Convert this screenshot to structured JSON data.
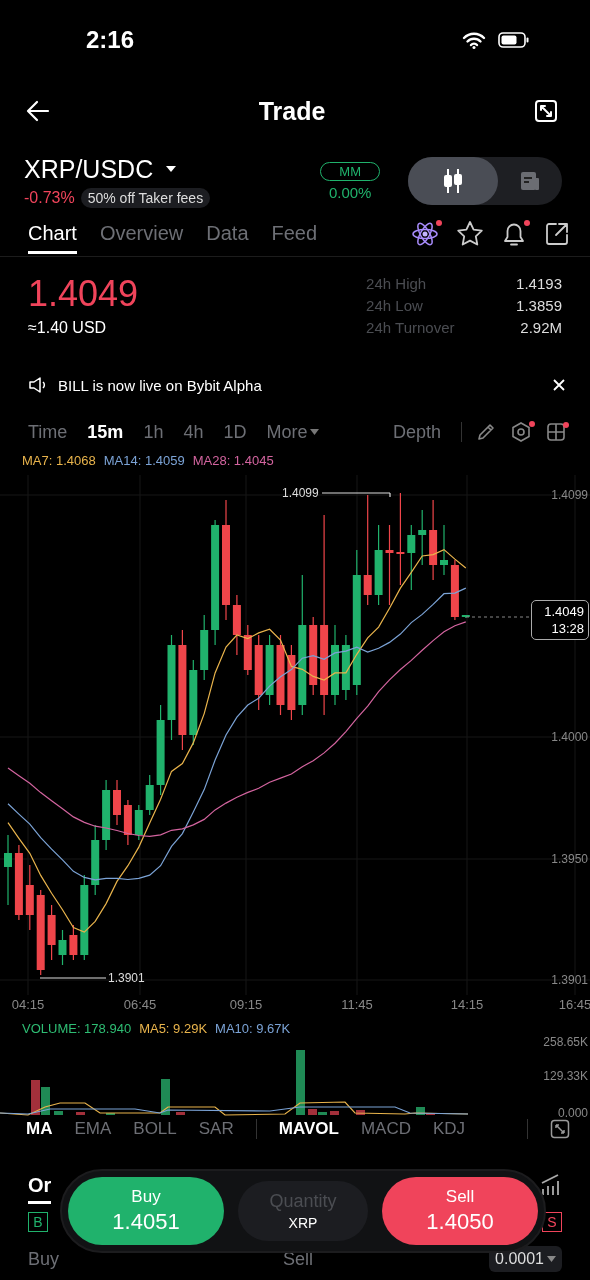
{
  "status_bar": {
    "time": "2:16"
  },
  "header": {
    "title": "Trade"
  },
  "pair": {
    "symbol": "XRP/USDC",
    "change": "-0.73%",
    "promo": "50% off Taker fees",
    "mm_label": "MM",
    "mm_value": "0.00%"
  },
  "view_toggle": [
    {
      "kind": "candles",
      "selected": true
    },
    {
      "kind": "news",
      "selected": false
    }
  ],
  "tabs": [
    {
      "label": "Chart",
      "selected": true
    },
    {
      "label": "Overview",
      "selected": false
    },
    {
      "label": "Data",
      "selected": false
    },
    {
      "label": "Feed",
      "selected": false
    }
  ],
  "tab_icons": [
    {
      "kind": "atom",
      "dot": true
    },
    {
      "kind": "star",
      "dot": false
    },
    {
      "kind": "bell",
      "dot": true
    },
    {
      "kind": "share",
      "dot": false
    }
  ],
  "price": {
    "last": "1.4049",
    "usd": "≈1.40 USD"
  },
  "stats": [
    {
      "label": "24h High",
      "value": "1.4193"
    },
    {
      "label": "24h Low",
      "value": "1.3859"
    },
    {
      "label": "24h Turnover",
      "value": "2.92M"
    }
  ],
  "notice": {
    "text": "BILL is now live on Bybit Alpha"
  },
  "intervals": [
    {
      "label": "Time",
      "selected": false,
      "dropdown": false
    },
    {
      "label": "15m",
      "selected": true,
      "dropdown": false
    },
    {
      "label": "1h",
      "selected": false,
      "dropdown": false
    },
    {
      "label": "4h",
      "selected": false,
      "dropdown": false
    },
    {
      "label": "1D",
      "selected": false,
      "dropdown": false
    },
    {
      "label": "More",
      "selected": false,
      "dropdown": true
    }
  ],
  "depth": "Depth",
  "chart_tools": [
    {
      "kind": "pencil",
      "dot": false
    },
    {
      "kind": "hexagon",
      "dot": true
    },
    {
      "kind": "grid",
      "dot": true
    }
  ],
  "ma_legend": [
    {
      "text": "MA7: 1.4068",
      "color": "#e9b44c"
    },
    {
      "text": "MA14: 1.4059",
      "color": "#7ba3d6"
    },
    {
      "text": "MA28: 1.4045",
      "color": "#d3649f"
    }
  ],
  "chart": {
    "high_label": "1.4099",
    "low_label": "1.3901",
    "y_labels": [
      "1.4099",
      "1.4000",
      "1.3950",
      "1.3901"
    ],
    "price_tag": {
      "value": "1.4049",
      "countdown": "13:28"
    },
    "x_labels": [
      "04:15",
      "06:45",
      "09:15",
      "11:45",
      "14:15",
      "16:45"
    ]
  },
  "volume": {
    "legend": [
      {
        "text": "VOLUME: 178.940",
        "color": "#2ebd73"
      },
      {
        "text": "MA5: 9.29K",
        "color": "#e9b44c"
      },
      {
        "text": "MA10: 9.67K",
        "color": "#7ba3d6"
      }
    ],
    "y_labels": [
      "258.65K",
      "129.33K",
      "0.000"
    ]
  },
  "indicator_groups": [
    {
      "items": [
        {
          "label": "MA",
          "selected": true
        },
        {
          "label": "EMA",
          "selected": false
        },
        {
          "label": "BOLL",
          "selected": false
        },
        {
          "label": "SAR",
          "selected": false
        }
      ]
    },
    {
      "items": [
        {
          "label": "MAVOL",
          "selected": true
        },
        {
          "label": "MACD",
          "selected": false
        },
        {
          "label": "KDJ",
          "selected": false
        }
      ]
    }
  ],
  "order_tab": "Or",
  "trade_bar": {
    "buy_label": "Buy",
    "buy_price": "1.4051",
    "quantity_placeholder": "Quantity",
    "quantity_unit": "XRP",
    "sell_label": "Sell",
    "sell_price": "1.4050"
  },
  "order_book": {
    "buy_badge": "B",
    "sell_badge": "S",
    "buy_header": "Buy",
    "sell_header": "Sell",
    "precision": "0.0001"
  }
}
